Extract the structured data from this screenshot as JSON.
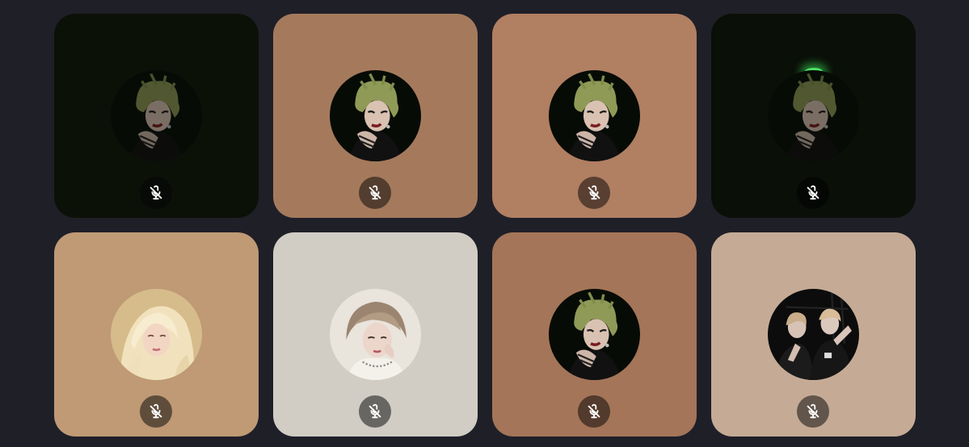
{
  "participants": [
    {
      "tile_color": "#0c1108",
      "button_color": "#070a06",
      "avatar": "green-hair-portrait",
      "speaking_glow": false,
      "muted": true,
      "dim": true
    },
    {
      "tile_color": "#a57a5c",
      "button_color": "#533d2e",
      "avatar": "green-hair-portrait",
      "speaking_glow": false,
      "muted": true,
      "dim": false
    },
    {
      "tile_color": "#b17f62",
      "button_color": "#583f31",
      "avatar": "green-hair-portrait",
      "speaking_glow": false,
      "muted": true,
      "dim": false
    },
    {
      "tile_color": "#0a0f07",
      "button_color": "#050705",
      "avatar": "green-hair-portrait",
      "speaking_glow": true,
      "muted": true,
      "dim": true
    },
    {
      "tile_color": "#bf9a75",
      "button_color": "#5f4d3b",
      "avatar": "blonde-hair-portrait",
      "speaking_glow": false,
      "muted": true,
      "dim": false
    },
    {
      "tile_color": "#d1cdc5",
      "button_color": "#686663",
      "avatar": "ash-hair-portrait",
      "speaking_glow": false,
      "muted": true,
      "dim": false
    },
    {
      "tile_color": "#a47558",
      "button_color": "#523a2c",
      "avatar": "green-hair-portrait",
      "speaking_glow": false,
      "muted": true,
      "dim": false
    },
    {
      "tile_color": "#c5ab96",
      "button_color": "#62554b",
      "avatar": "duo-photo",
      "speaking_glow": false,
      "muted": true,
      "dim": false
    }
  ],
  "icons": {
    "mute": "microphone-off-icon"
  }
}
